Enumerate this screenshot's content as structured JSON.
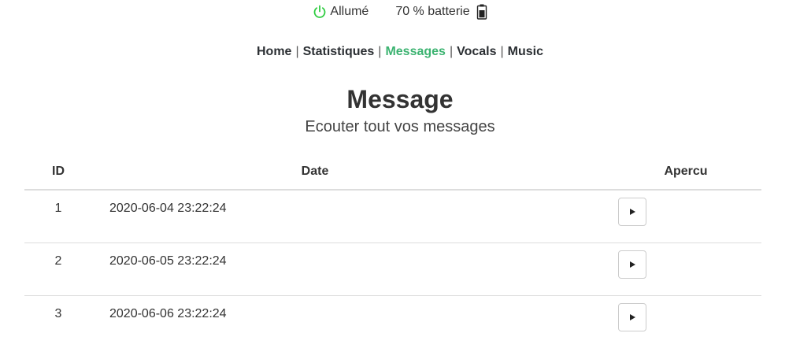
{
  "status": {
    "power_label": "Allumé",
    "power_color": "#2ecc40",
    "battery_label": "70 % batterie",
    "battery_level_percent": 70,
    "battery_color": "#222222"
  },
  "nav": {
    "items": [
      {
        "label": "Home",
        "active": false
      },
      {
        "label": "Statistiques",
        "active": false
      },
      {
        "label": "Messages",
        "active": true
      },
      {
        "label": "Vocals",
        "active": false
      },
      {
        "label": "Music",
        "active": false
      }
    ],
    "separator": "|",
    "active_color": "#3cb371"
  },
  "page": {
    "title": "Message",
    "subtitle": "Ecouter tout vos messages"
  },
  "table": {
    "headers": {
      "id": "ID",
      "date": "Date",
      "apercu": "Apercu"
    },
    "rows": [
      {
        "id": "1",
        "date": "2020-06-04 23:22:24"
      },
      {
        "id": "2",
        "date": "2020-06-05 23:22:24"
      },
      {
        "id": "3",
        "date": "2020-06-06 23:22:24"
      }
    ]
  },
  "icons": {
    "power": "power-icon",
    "battery": "battery-icon",
    "play": "play-icon"
  }
}
